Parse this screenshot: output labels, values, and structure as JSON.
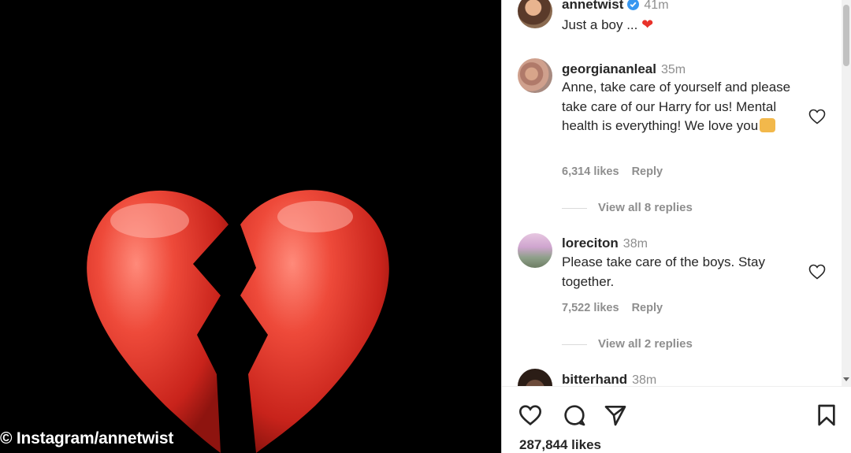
{
  "media": {
    "credit": "© Instagram/annetwist"
  },
  "post": {
    "author": "annetwist",
    "time": "41m",
    "caption": "Just a boy ...",
    "caption_emoji": "❤",
    "likes": "287,844 likes"
  },
  "comments": [
    {
      "user": "georgiananleal",
      "time": "35m",
      "text": "Anne, take care of yourself and please take care of our Harry for us! Mental health is everything! We love you",
      "likes": "6,314 likes",
      "reply": "Reply",
      "view_replies": "View all 8 replies"
    },
    {
      "user": "loreciton",
      "time": "38m",
      "text": "Please take care of the boys. Stay together.",
      "likes": "7,522 likes",
      "reply": "Reply",
      "view_replies": "View all 2 replies"
    },
    {
      "user": "bitterhand",
      "time": "38m"
    }
  ],
  "icons": {
    "like": "heart-outline-icon",
    "comment": "comment-bubble-icon",
    "share": "paper-plane-icon",
    "save": "bookmark-icon",
    "verified": "verified-badge-icon"
  },
  "colors": {
    "heart_red": "#e8322a",
    "verified_blue": "#3897f0",
    "muted_text": "#8e8e8e"
  }
}
